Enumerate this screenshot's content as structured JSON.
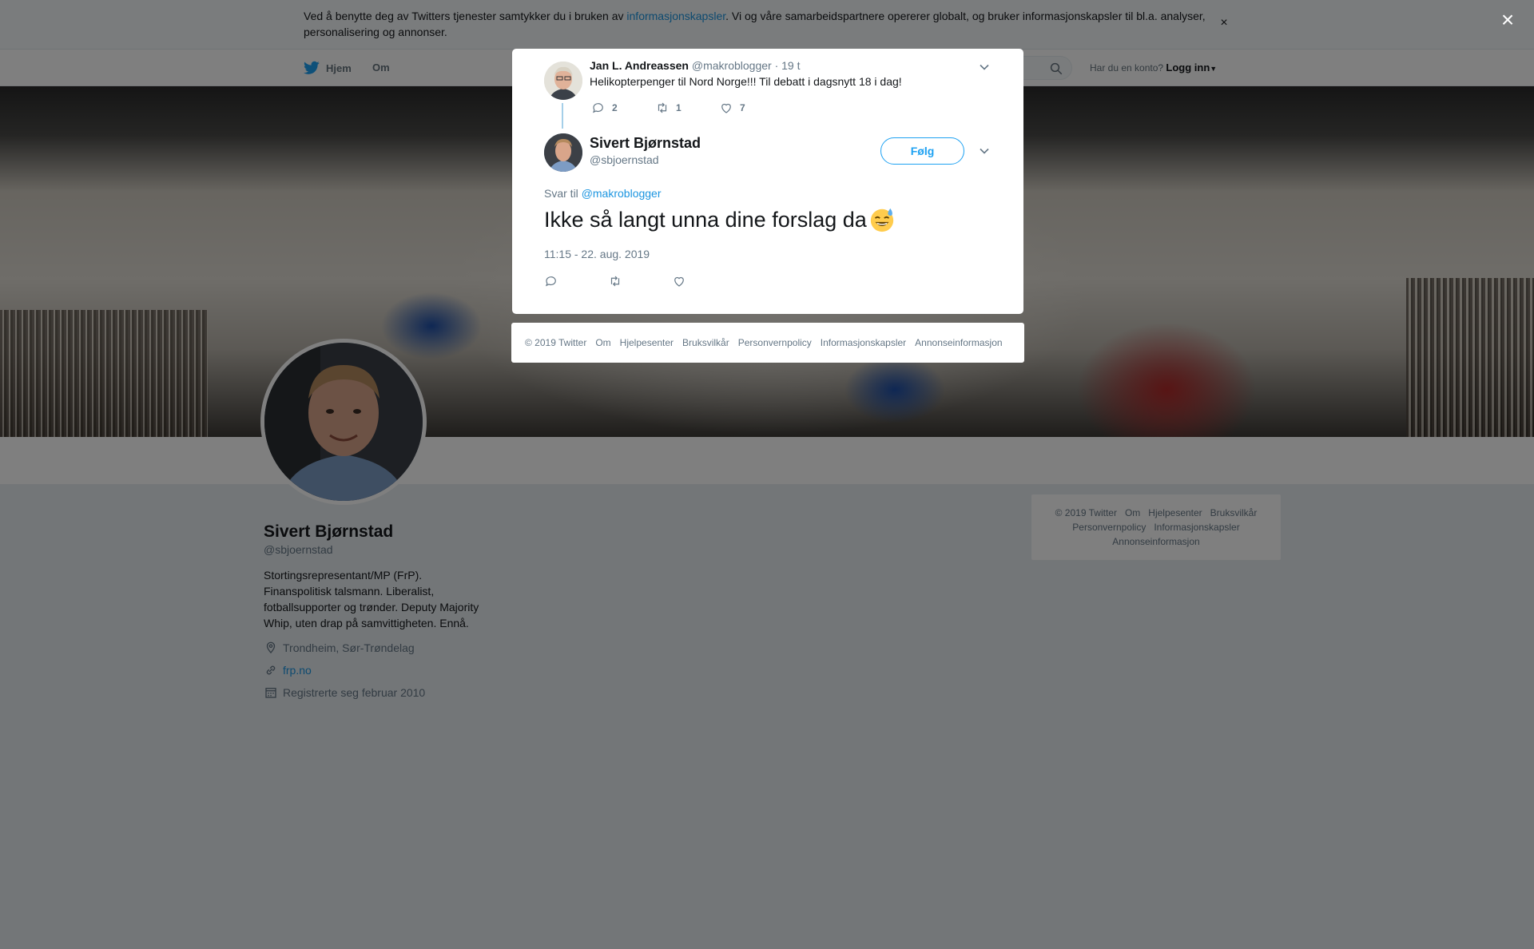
{
  "cookie": {
    "text_before": "Ved å benytte deg av Twitters tjenester samtykker du i bruken av ",
    "link": "informasjonskapsler",
    "text_after": ". Vi og våre samarbeidspartnere opererer globalt, og bruker informasjonskapsler til bl.a. analyser, personalisering og annonser.",
    "close": "×"
  },
  "topbar": {
    "home": "Hjem",
    "about": "Om",
    "login_question": "Har du en konto?",
    "login_link": "Logg inn"
  },
  "profile": {
    "name": "Sivert Bjørnstad",
    "handle": "@sbjoernstad",
    "bio": "Stortingsrepresentant/MP (FrP). Finanspolitisk talsmann. Liberalist, fotballsupporter og trønder. Deputy Majority Whip, uten drap på samvittigheten. Ennå.",
    "location": "Trondheim, Sør-Trøndelag",
    "website": "frp.no",
    "joined": "Registrerte seg februar 2010"
  },
  "side_footer": {
    "items": [
      "© 2019 Twitter",
      "Om",
      "Hjelpesenter",
      "Bruksvilkår",
      "Personvernpolicy",
      "Informasjonskapsler",
      "Annonseinformasjon"
    ]
  },
  "modal": {
    "close": "×",
    "parent": {
      "name": "Jan L. Andreassen",
      "handle": "@makroblogger",
      "time": "· 19 t",
      "text": "Helikopterpenger til Nord Norge!!! Til debatt i dagsnytt 18 i dag!",
      "replies": "2",
      "retweets": "1",
      "likes": "7"
    },
    "main": {
      "name": "Sivert Bjørnstad",
      "handle": "@sbjoernstad",
      "follow": "Følg",
      "reply_prefix": "Svar til ",
      "reply_handle": "@makroblogger",
      "text": "Ikke så langt unna dine forslag da",
      "timestamp": "11:15 - 22. aug. 2019"
    }
  },
  "modal_footer": {
    "items": [
      "© 2019 Twitter",
      "Om",
      "Hjelpesenter",
      "Bruksvilkår",
      "Personvernpolicy",
      "Informasjonskapsler",
      "Annonseinformasjon"
    ]
  },
  "colors": {
    "accent": "#1da1f2",
    "link": "#1b95e0",
    "muted": "#657786",
    "overlay": "rgba(0,0,0,0.5)"
  }
}
